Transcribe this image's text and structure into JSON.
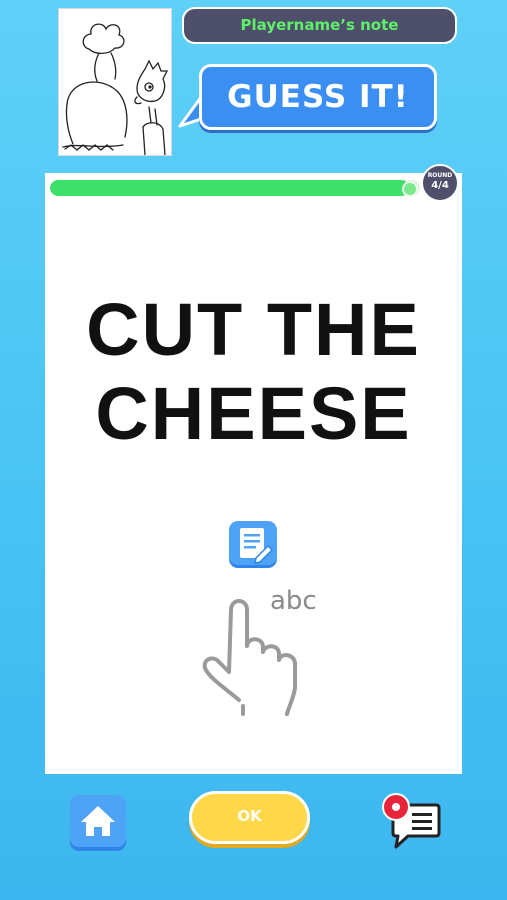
{
  "header": {
    "note_title": "Playername’s note",
    "guess_label": "GUESS IT!"
  },
  "card": {
    "prompt_line1": "CUT THE",
    "prompt_line2": "CHEESE",
    "tutorial_text": "abc"
  },
  "round": {
    "label": "ROUND",
    "value": "4/4"
  },
  "progress": {
    "fraction": 0.97
  },
  "footer": {
    "ok_label": "OK"
  },
  "colors": {
    "background": "#49c3f3",
    "note_pill": "#4e4f6b",
    "note_text": "#5ff06a",
    "guess_bubble": "#3c8ff2",
    "progress": "#3fe06a",
    "ok_button": "#ffd84a",
    "report_red": "#e8243a"
  },
  "icons": {
    "thumbnail": "player-drawing-thumbnail",
    "notepad": "notepad-pencil-icon",
    "hand": "tap-hand-icon",
    "home": "home-icon",
    "report": "report-chat-icon"
  }
}
